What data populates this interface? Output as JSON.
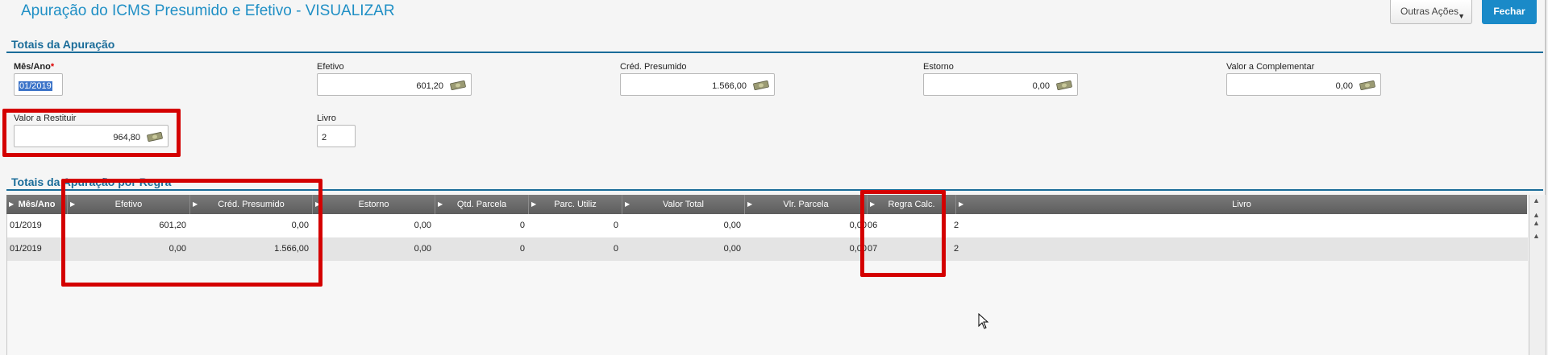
{
  "header": {
    "title": "Apuração do ICMS Presumido e Efetivo - VISUALIZAR",
    "outras_acoes": "Outras Ações",
    "fechar": "Fechar"
  },
  "totais": {
    "section_title": "Totais da Apuração",
    "mes_ano": {
      "label": "Mês/Ano",
      "required": "*",
      "value": "01/2019"
    },
    "efetivo": {
      "label": "Efetivo",
      "value": "601,20"
    },
    "cred_presumido": {
      "label": "Créd. Presumido",
      "value": "1.566,00"
    },
    "estorno": {
      "label": "Estorno",
      "value": "0,00"
    },
    "valor_complementar": {
      "label": "Valor a Complementar",
      "value": "0,00"
    },
    "valor_restituir": {
      "label": "Valor a Restituir",
      "value": "964,80"
    },
    "livro": {
      "label": "Livro",
      "value": "2"
    }
  },
  "regra": {
    "section_title": "Totais da Apuração por Regra",
    "columns": [
      "Mês/Ano",
      "Efetivo",
      "Créd. Presumido",
      "Estorno",
      "Qtd. Parcela",
      "Parc. Utiliz",
      "Valor Total",
      "Vlr. Parcela",
      "Regra Calc.",
      "Livro"
    ],
    "rows": [
      [
        "01/2019",
        "601,20",
        "0,00",
        "0,00",
        "0",
        "0",
        "0,00",
        "0,00",
        "06",
        "2"
      ],
      [
        "01/2019",
        "0,00",
        "1.566,00",
        "0,00",
        "0",
        "0",
        "0,00",
        "0,00",
        "07",
        "2"
      ]
    ]
  },
  "icons": {
    "money": "money-bill-icon",
    "sort": "sort-arrow-icon",
    "dropdown": "caret-down-icon"
  },
  "colors": {
    "accent": "#1a8ac8",
    "title": "#1f8fc5",
    "highlight": "#d40000",
    "section": "#1a6c99"
  }
}
